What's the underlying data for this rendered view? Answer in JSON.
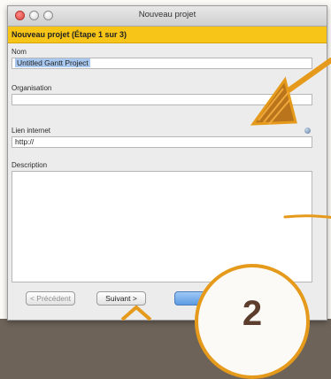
{
  "window": {
    "title": "Nouveau projet",
    "banner": "Nouveau projet (Étape 1 sur 3)"
  },
  "fields": {
    "nom_label": "Nom",
    "nom_value": "Untitled Gantt Project",
    "organisation_label": "Organisation",
    "organisation_value": "",
    "lien_label": "Lien internet",
    "lien_value": "http://",
    "description_label": "Description"
  },
  "buttons": {
    "previous": "< Précédent",
    "next": "Suivant >"
  },
  "overlay": {
    "badge_number": "2"
  },
  "colors": {
    "banner": "#f7c518",
    "annotation_orange": "#e59a1c"
  }
}
